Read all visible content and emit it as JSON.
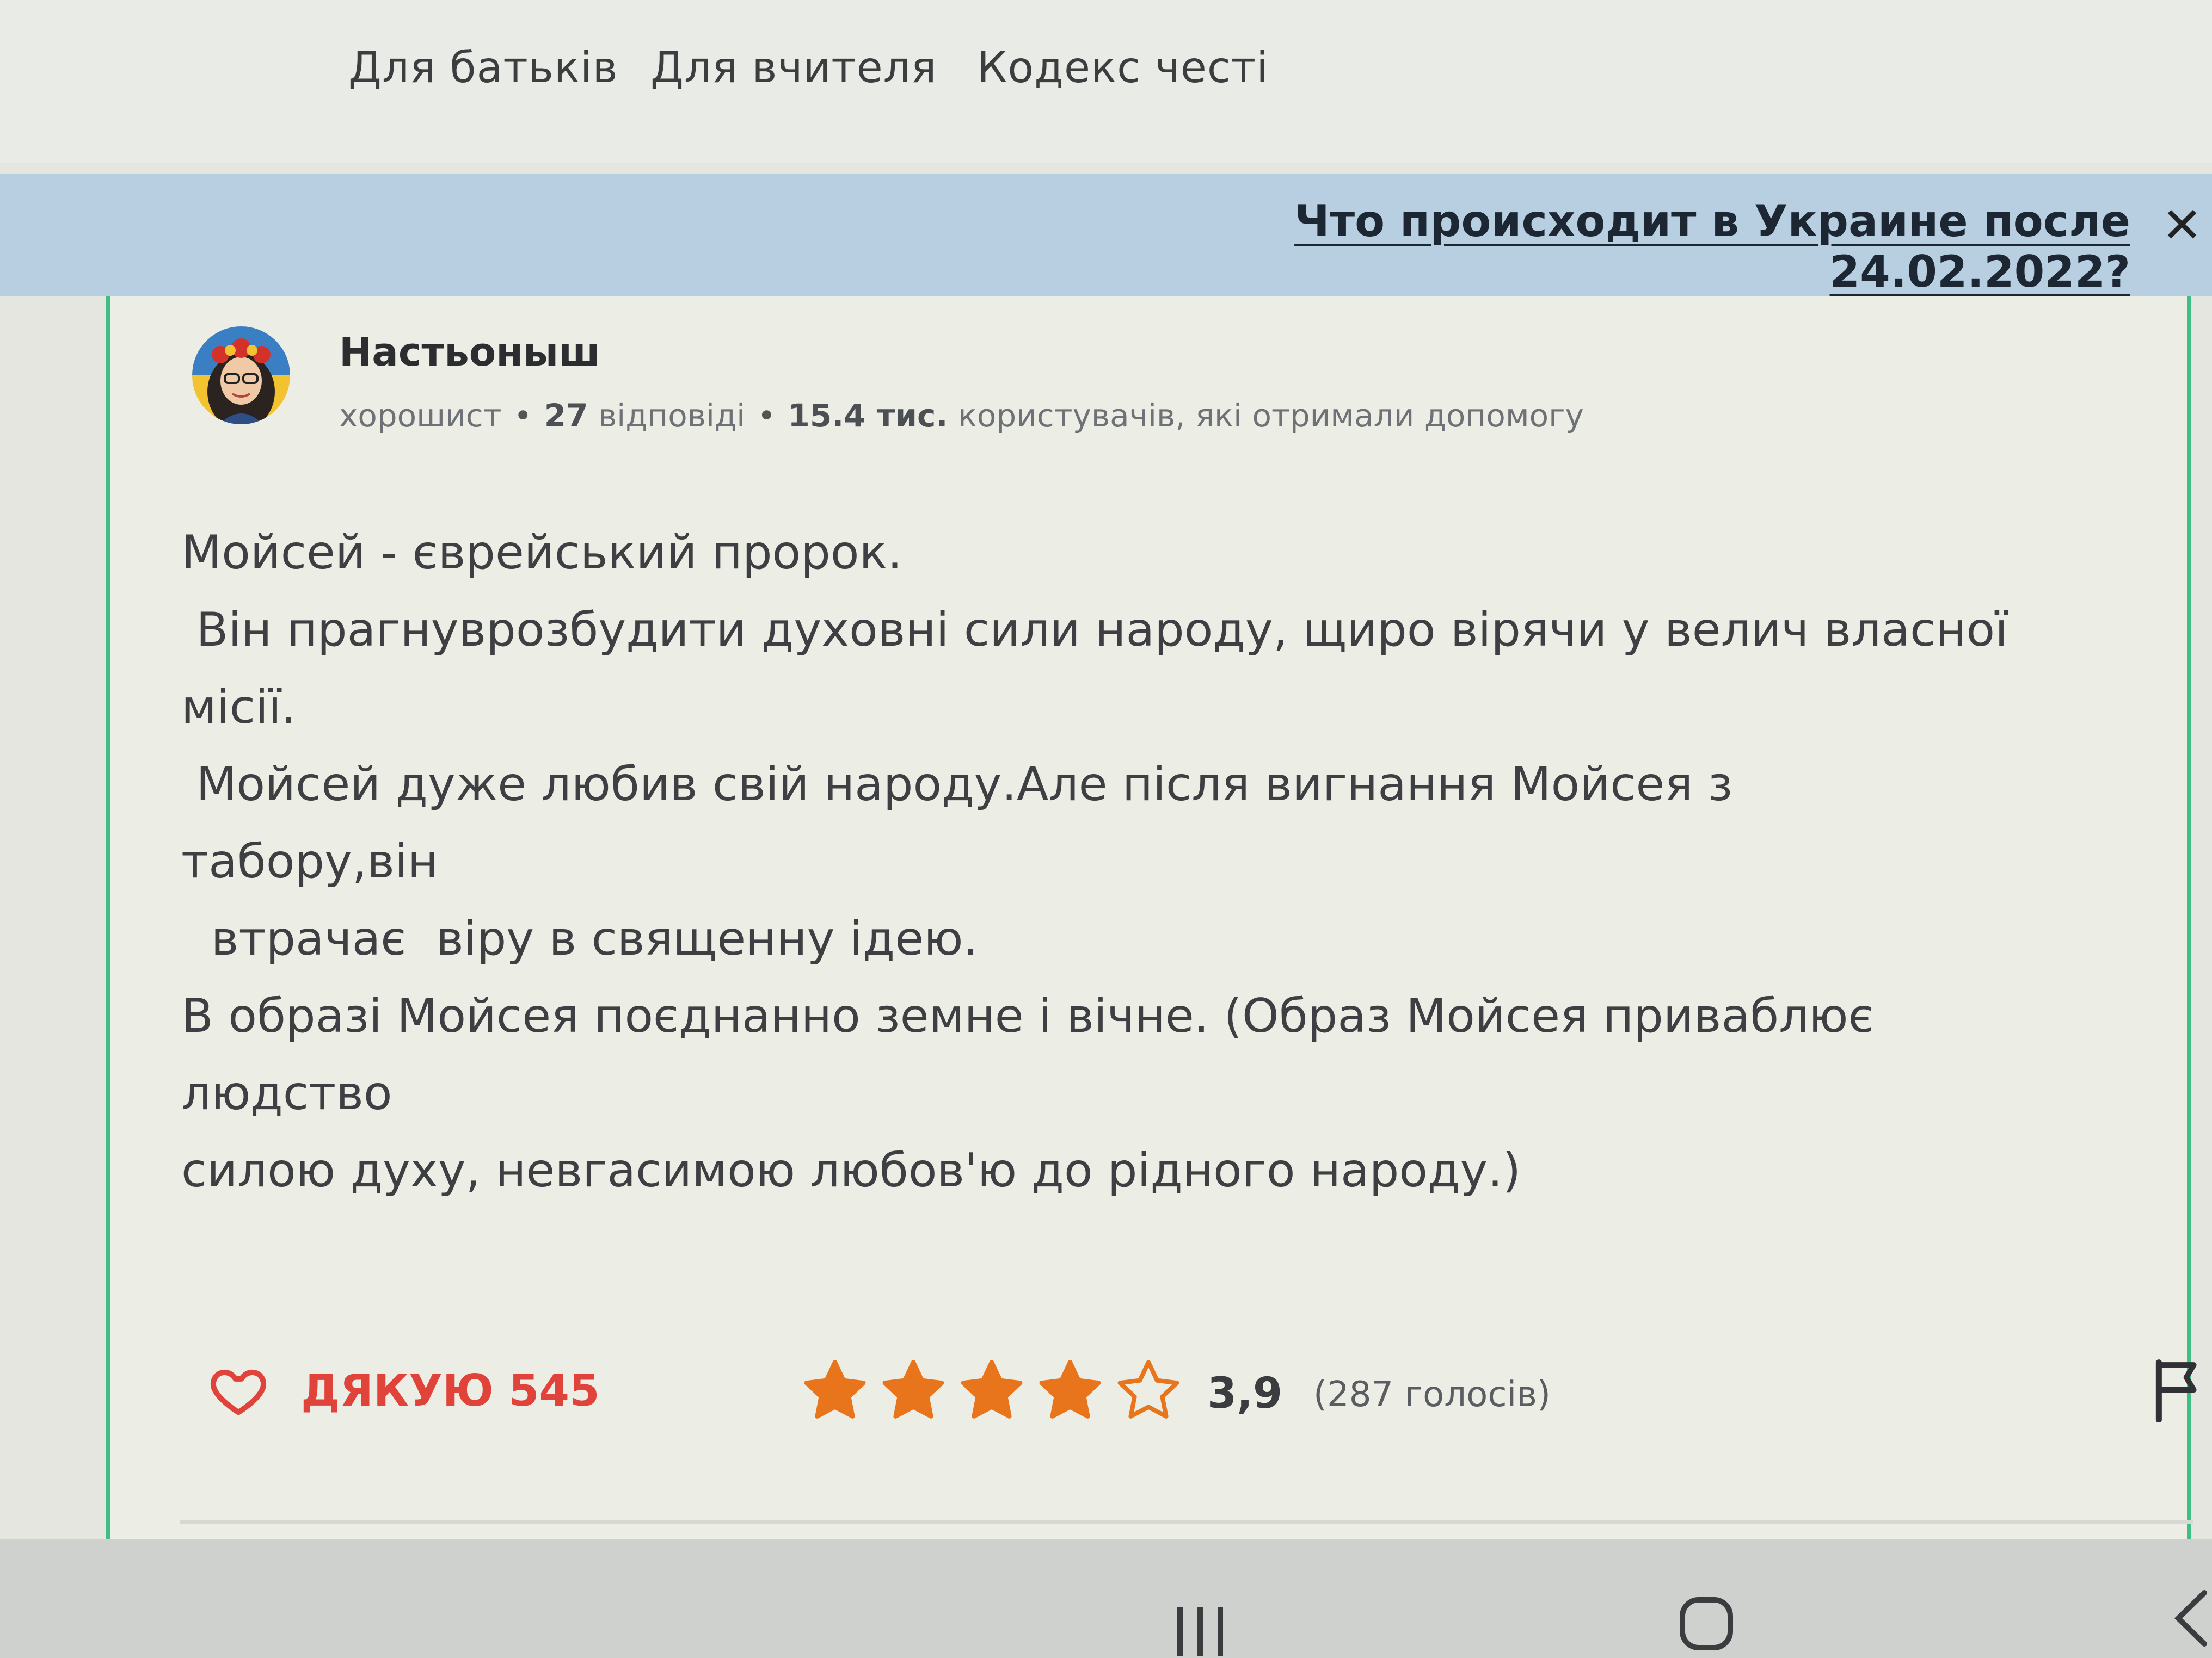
{
  "topnav": {
    "links": [
      "Для батьків",
      "Для вчителя",
      "Кодекс честі"
    ]
  },
  "banner": {
    "link_text": "Что происходит в Украине после 24.02.2022?",
    "close_icon": "close-icon"
  },
  "answer_card": {
    "author": {
      "name": "Настьоныш",
      "rank": "хорошист",
      "answers_count": "27",
      "answers_label": "відповіді",
      "helped_count": "15.4 тис.",
      "helped_label": "користувачів, які отримали допомогу",
      "avatar_icon": "avatar-image"
    },
    "body_lines": [
      "Мойсей - єврейський пророк.",
      " Він прагнуврозбудити духовні сили народу, щиро вірячи у велич власної",
      "місії.",
      " Мойсей дуже любив свій народу.Але після вигнання Мойсея з",
      "табору,він",
      "  втрачає  віру в священну ідею.",
      "В образі Мойсея поєднанно земне і вічне. (Образ Мойсея приваблює",
      "людство",
      "силою духу, невгасимою любов'ю до рідного народу.)"
    ],
    "footer": {
      "thanks_label": "ДЯКУЮ 545",
      "thanks_icon": "heart-icon",
      "rating": 3.9,
      "rating_display": "3,9",
      "votes_label": "(287 голосів)",
      "stars_max": 5,
      "star_color": "#e8741c",
      "report_icon": "flag-icon"
    }
  },
  "system_nav": {
    "icons": [
      "recent-apps-icon",
      "home-icon",
      "back-icon"
    ]
  },
  "colors": {
    "accent_green": "#3fbf86",
    "banner_blue": "#b7cfe0",
    "thanks_red": "#e0433a"
  }
}
